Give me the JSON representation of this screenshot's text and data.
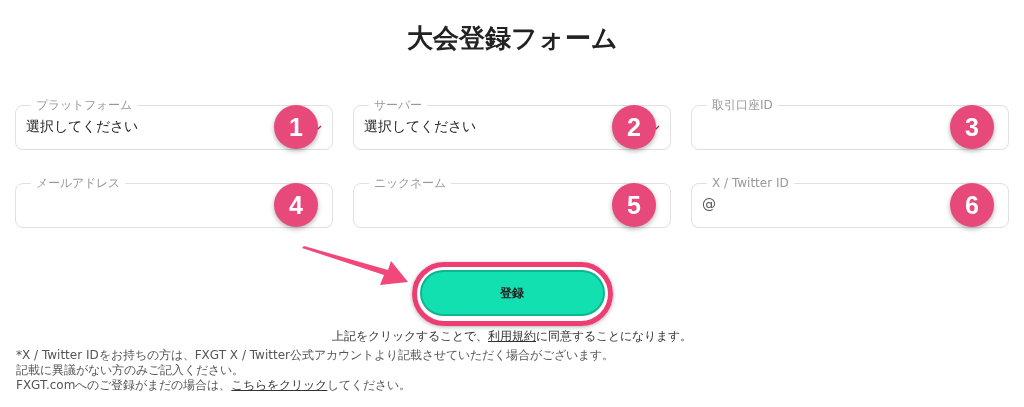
{
  "title": "大会登録フォーム",
  "fields": [
    {
      "kind": "select",
      "label": "プラットフォーム",
      "value": "選択してください",
      "marker": "1"
    },
    {
      "kind": "select",
      "label": "サーバー",
      "value": "選択してください",
      "marker": "2"
    },
    {
      "kind": "text",
      "label": "取引口座ID",
      "marker": "3"
    },
    {
      "kind": "text",
      "label": "メールアドレス",
      "marker": "4"
    },
    {
      "kind": "text",
      "label": "ニックネーム",
      "marker": "5"
    },
    {
      "kind": "text",
      "label": "X / Twitter ID",
      "prefix": "@",
      "marker": "6"
    }
  ],
  "submit": {
    "label": "登録",
    "highlighted": true
  },
  "agreement": {
    "before": "上記をクリックすることで、",
    "link": "利用規約",
    "after": "に同意することになります。"
  },
  "notes": [
    {
      "text": "*X / Twitter IDをお持ちの方は、FXGT X / Twitter公式アカウントより記載させていただく場合がございます。"
    },
    {
      "text": "記載に異議がない方のみご記入ください。"
    },
    {
      "text": "FXGT.comへのご登録がまだの場合は、",
      "link": "こちらをクリック",
      "after": "してください。"
    }
  ]
}
